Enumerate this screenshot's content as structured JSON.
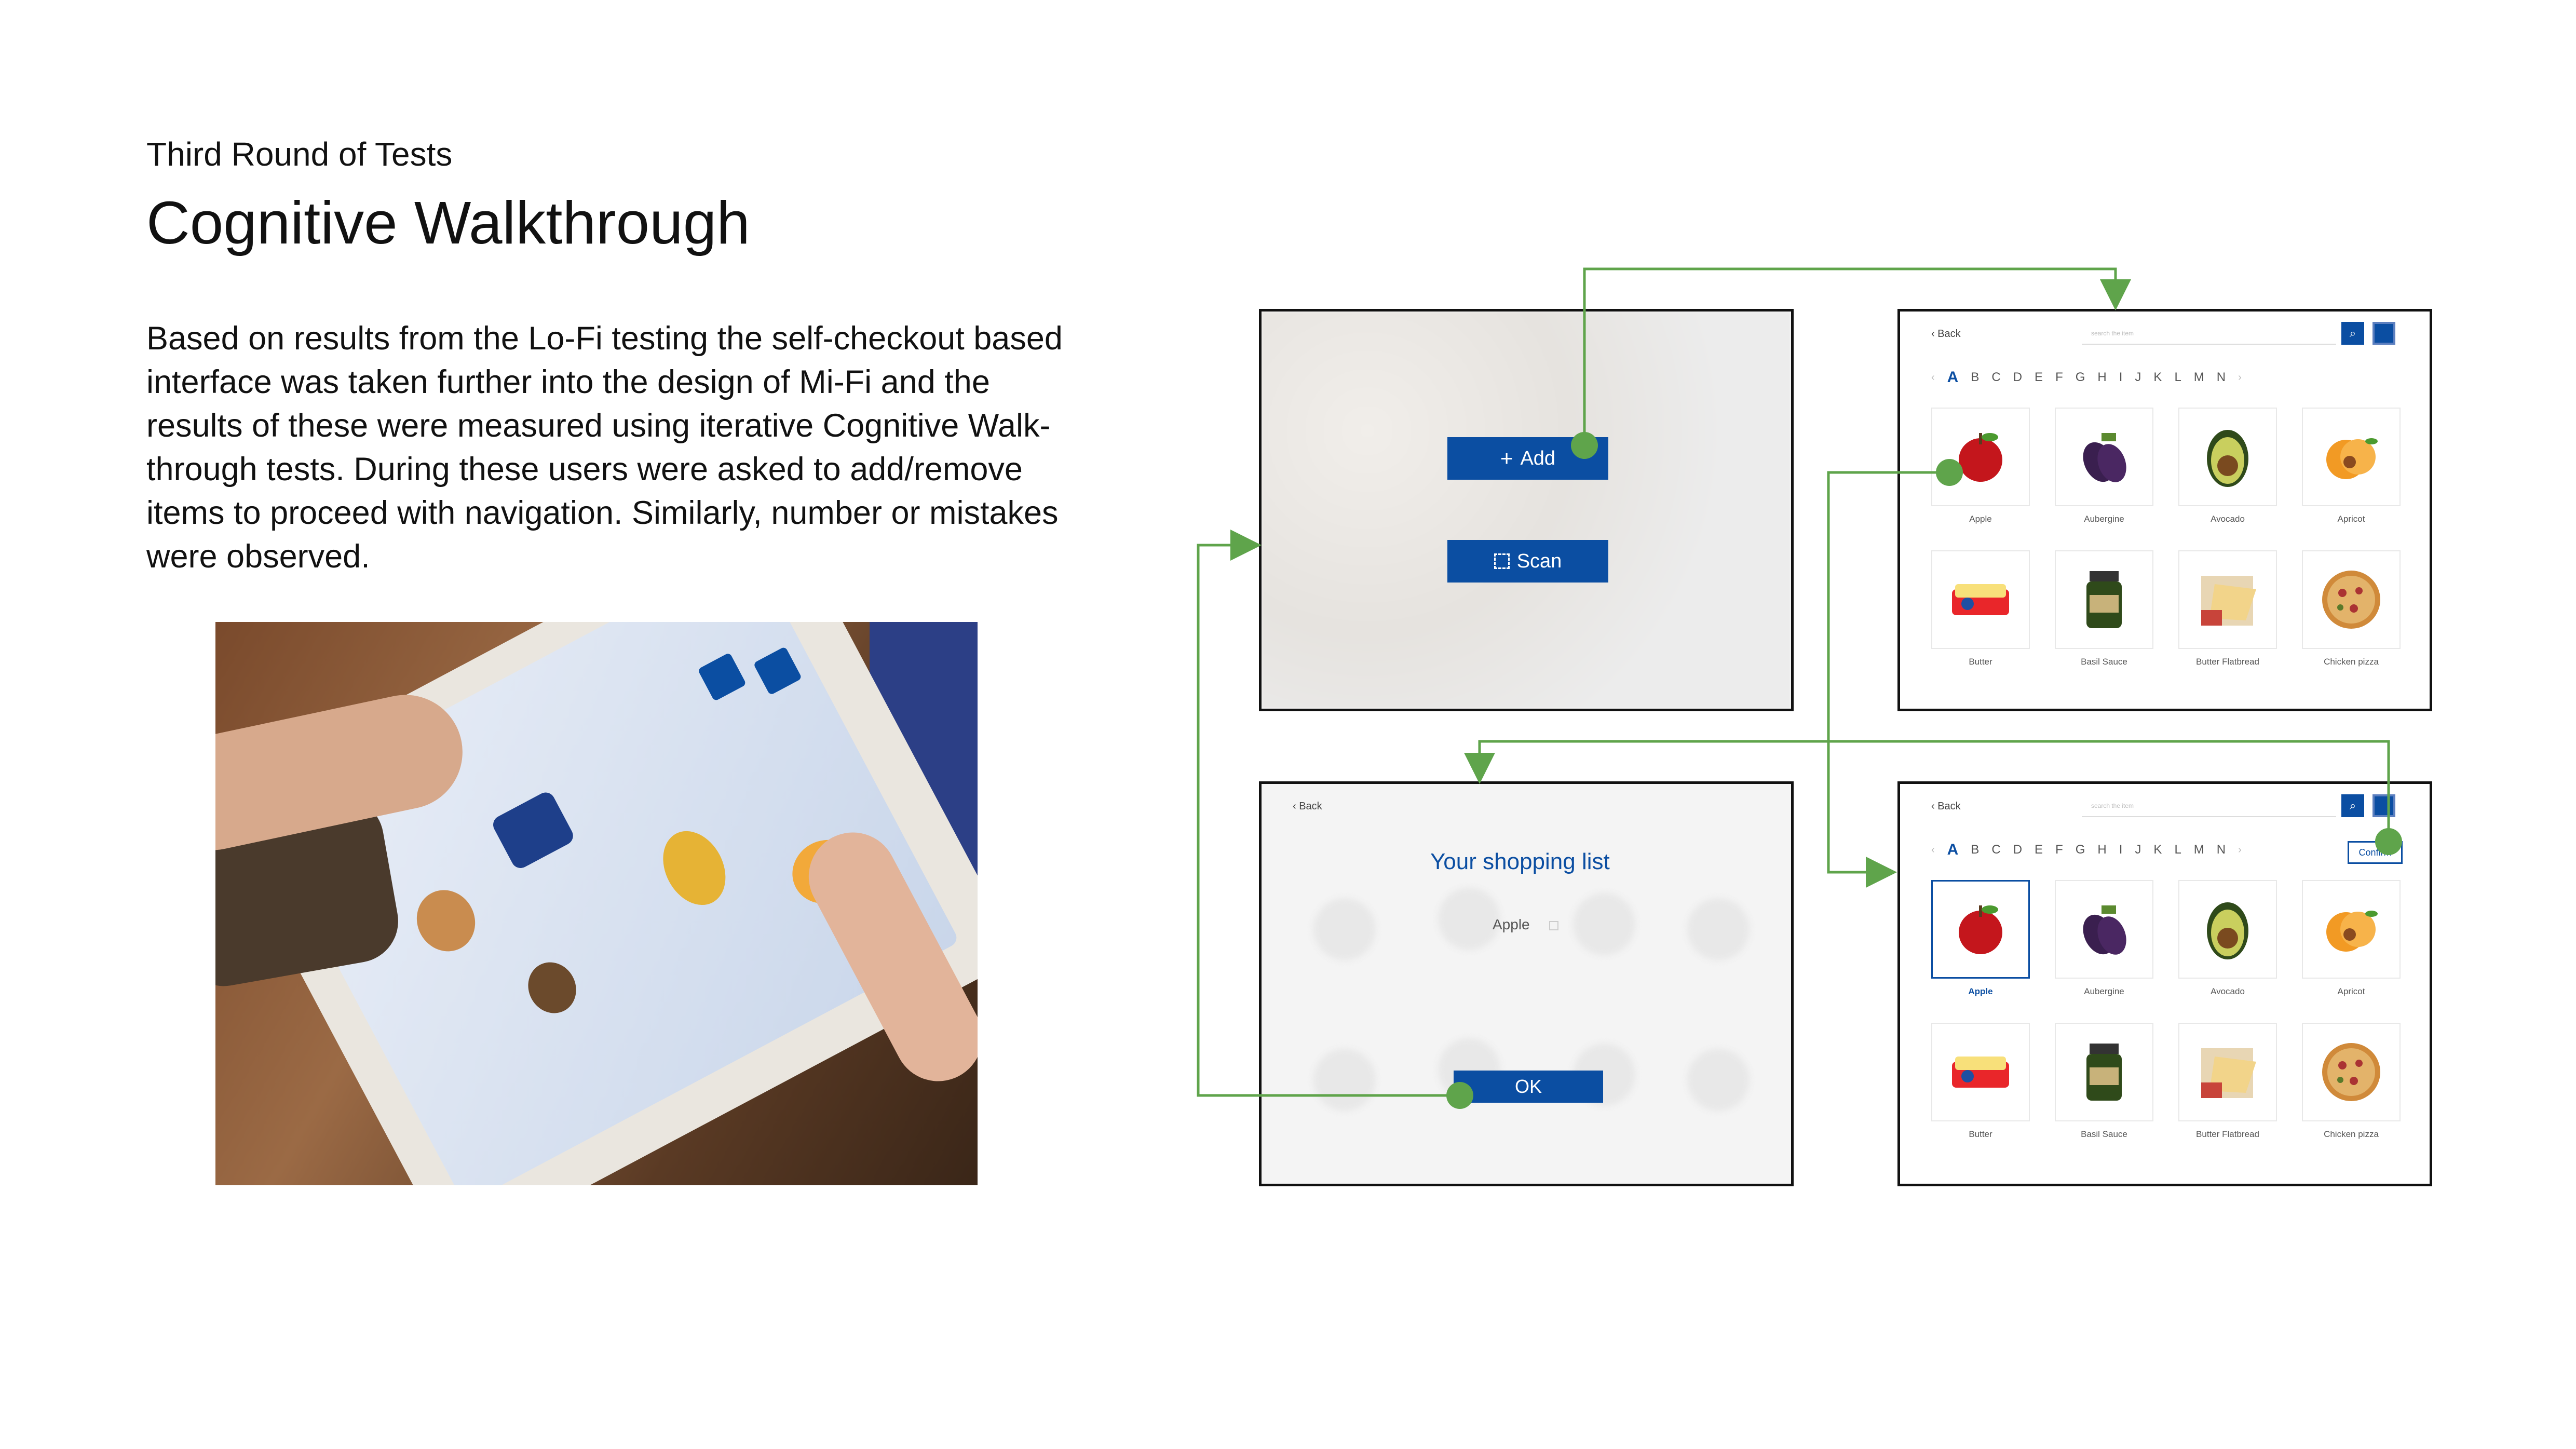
{
  "header": {
    "subtitle": "Third Round of Tests",
    "title": "Cognitive Walkthrough"
  },
  "body": {
    "paragraph": "Based on results from the Lo-Fi testing the self-checkout based interface was taken further into the design of Mi-Fi and the results of these were measured using iterative Cognitive Walk-through tests. During these users were asked to add/remove items to proceed with navigation. Similarly, number or mistakes were observed."
  },
  "screen_home": {
    "add_label": "Add",
    "scan_label": "Scan",
    "add_icon": "plus-icon",
    "scan_icon": "scan-icon"
  },
  "browse": {
    "back_label": "Back",
    "search_placeholder": "search the item",
    "letters": [
      "A",
      "B",
      "C",
      "D",
      "E",
      "F",
      "G",
      "H",
      "I",
      "J",
      "K",
      "L",
      "M",
      "N"
    ],
    "products": [
      "Apple",
      "Aubergine",
      "Avocado",
      "Apricot",
      "Butter",
      "Basil Sauce",
      "Butter Flatbread",
      "Chicken pizza"
    ]
  },
  "browse_selected": {
    "confirm_label": "Confirm"
  },
  "shopping_list": {
    "back_label": "Back",
    "title": "Your shopping list",
    "item": "Apple",
    "ok_label": "OK"
  },
  "colors": {
    "brand_blue": "#0b4ea2",
    "flow_green": "#5fa44b"
  }
}
